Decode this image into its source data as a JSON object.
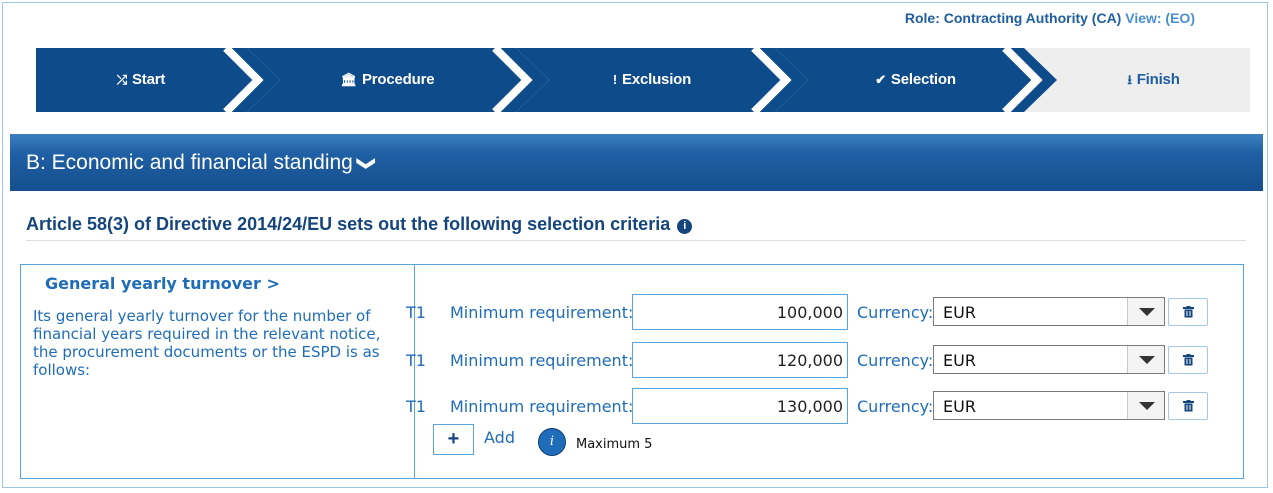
{
  "header": {
    "role_text": "Role: Contracting Authority (CA)",
    "view_text": "View: (EO)"
  },
  "stepper": {
    "steps": [
      {
        "label": "Start",
        "icon": "shuffle-icon",
        "glyph": "⤮"
      },
      {
        "label": "Procedure",
        "icon": "institution-icon",
        "glyph": "🏛"
      },
      {
        "label": "Exclusion",
        "icon": "exclamation-icon",
        "glyph": "!"
      },
      {
        "label": "Selection",
        "icon": "check-circle-icon",
        "glyph": "✔"
      },
      {
        "label": "Finish",
        "icon": "download-icon",
        "glyph": "⭳"
      }
    ],
    "active_color": "#0e4b8a",
    "inactive_color": "#eeeeee"
  },
  "section": {
    "title": "B: Economic and financial standing",
    "chevron": "❯"
  },
  "article": {
    "text": "Article 58(3) of Directive 2014/24/EU sets out the following selection criteria",
    "info_glyph": "i"
  },
  "criterion": {
    "title": "General yearly turnover >",
    "description": "Its general yearly turnover for the number of financial years required in the relevant notice, the procurement documents or the ESPD is as follows:"
  },
  "requirements": [
    {
      "code": "T1",
      "label": "Minimum requirement:",
      "amount": "100,000",
      "currency_label": "Currency:",
      "currency": "EUR"
    },
    {
      "code": "T1",
      "label": "Minimum requirement:",
      "amount": "120,000",
      "currency_label": "Currency:",
      "currency": "EUR"
    },
    {
      "code": "T1",
      "label": "Minimum requirement:",
      "amount": "130,000",
      "currency_label": "Currency:",
      "currency": "EUR"
    }
  ],
  "actions": {
    "add_glyph": "+",
    "add_label": "Add",
    "max_glyph": "i",
    "max_label": "Maximum 5"
  }
}
